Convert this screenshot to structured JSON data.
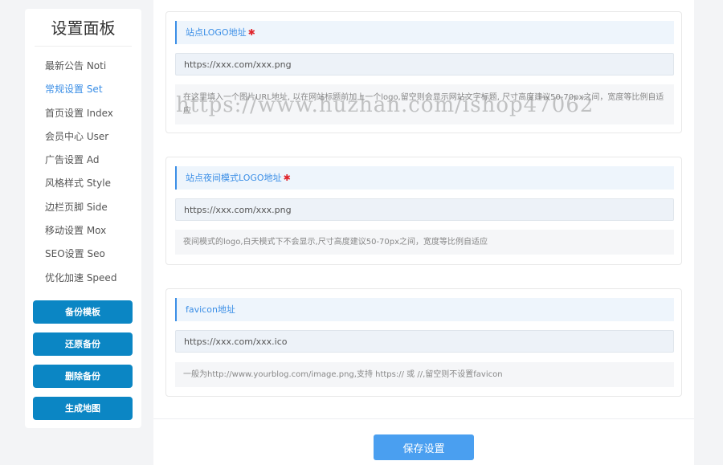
{
  "sidebar": {
    "title": "设置面板",
    "items": [
      {
        "label": "最新公告 Noti"
      },
      {
        "label": "常规设置 Set",
        "active": true
      },
      {
        "label": "首页设置 Index"
      },
      {
        "label": "会员中心 User"
      },
      {
        "label": "广告设置 Ad"
      },
      {
        "label": "风格样式 Style"
      },
      {
        "label": "边栏页脚 Side"
      },
      {
        "label": "移动设置 Mox"
      },
      {
        "label": "SEO设置 Seo"
      },
      {
        "label": "优化加速 Speed"
      }
    ],
    "buttons": {
      "backup": "备份模板",
      "restore": "还原备份",
      "delete": "删除备份",
      "sitemap": "生成地图"
    }
  },
  "fields": {
    "logo": {
      "label": "站点LOGO地址",
      "required_mark": "✱",
      "value": "https://xxx.com/xxx.png",
      "hint": "在这里填入一个图片URL地址, 以在网站标题前加上一个logo,留空则会显示网站文字标题, 尺寸高度建议50-70px之间，宽度等比例自适应"
    },
    "dark_logo": {
      "label": "站点夜间模式LOGO地址",
      "required_mark": "✱",
      "value": "https://xxx.com/xxx.png",
      "hint": "夜间模式的logo,白天模式下不会显示,尺寸高度建议50-70px之间，宽度等比例自适应"
    },
    "favicon": {
      "label": "favicon地址",
      "value": "https://xxx.com/xxx.ico",
      "hint": "一般为http://www.yourblog.com/image.png,支持 https:// 或 //,留空则不设置favicon"
    }
  },
  "footer": {
    "save_label": "保存设置"
  },
  "watermark": "https://www.huzhan.com/ishop47062",
  "colors": {
    "accent": "#3a8ee6",
    "sidebar_button": "#0b86c4",
    "save_button": "#4a9ff0",
    "required": "#e0242b"
  }
}
